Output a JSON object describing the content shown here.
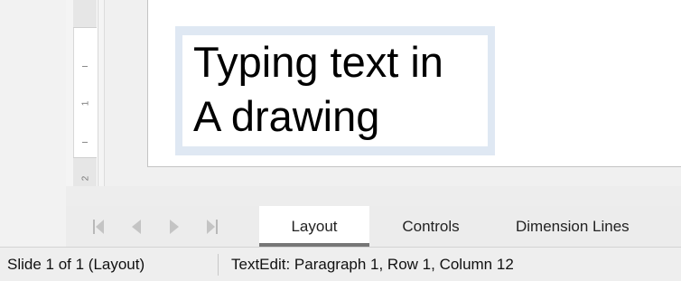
{
  "ruler": {
    "label_1": "1",
    "label_2": "2"
  },
  "slide": {
    "text_lines": [
      "Typing text in",
      "A drawing"
    ]
  },
  "navigation": {
    "first_icon": "first-slide-icon",
    "prev_icon": "previous-slide-icon",
    "next_icon": "next-slide-icon",
    "last_icon": "last-slide-icon"
  },
  "tabs": [
    {
      "label": "Layout",
      "active": true
    },
    {
      "label": "Controls",
      "active": false
    },
    {
      "label": "Dimension Lines",
      "active": false
    }
  ],
  "statusbar": {
    "slide_info": "Slide 1 of 1 (Layout)",
    "edit_info": "TextEdit: Paragraph 1, Row 1, Column 12"
  }
}
